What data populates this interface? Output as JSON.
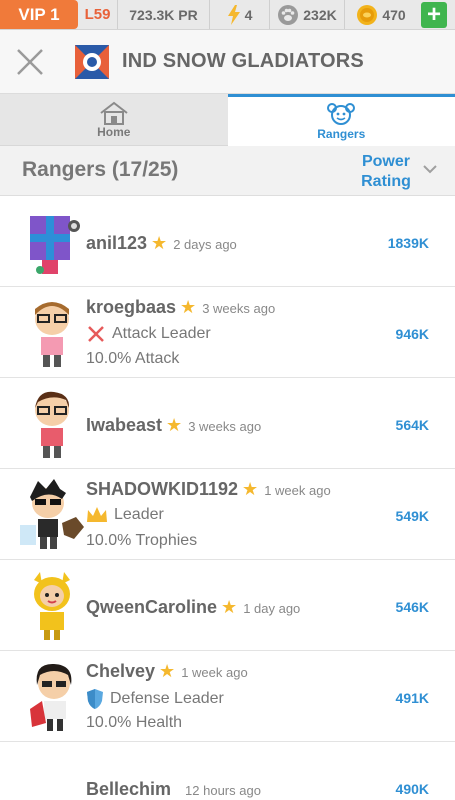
{
  "status_bar": {
    "vip": "VIP 1",
    "level": "L59",
    "power_rating": "723.3K PR",
    "energy": "4",
    "paws": "232K",
    "coins": "470",
    "plus": "+"
  },
  "team": {
    "name": "IND SNOW GLADIATORS"
  },
  "tabs": [
    {
      "label": "Home",
      "icon": "house-icon",
      "active": false
    },
    {
      "label": "Rangers",
      "icon": "rangers-icon",
      "active": true
    }
  ],
  "section": {
    "title": "Rangers (17/25)",
    "sort_line1": "Power",
    "sort_line2": "Rating"
  },
  "colors": {
    "accent": "#2f8fd3",
    "vip": "#f07a3a",
    "star": "#f5b82e",
    "plus": "#3fb54e"
  },
  "rangers": [
    {
      "name": "anil123",
      "seen": "2 days ago",
      "role": "",
      "bonus": "",
      "power": "1839K",
      "avatar": "gift-box-avatar"
    },
    {
      "name": "kroegbaas",
      "seen": "3 weeks ago",
      "role": "Attack Leader",
      "role_icon": "swords-icon",
      "bonus": "10.0% Attack",
      "power": "946K",
      "avatar": "glasses-avatar"
    },
    {
      "name": "Iwabeast",
      "seen": "3 weeks ago",
      "role": "",
      "bonus": "",
      "power": "564K",
      "avatar": "glasses-avatar-2"
    },
    {
      "name": "SHADOWKID1192",
      "seen": "1 week ago",
      "role": "Leader",
      "role_icon": "crown-icon",
      "bonus": "10.0% Trophies",
      "power": "549K",
      "avatar": "shadow-avatar"
    },
    {
      "name": "QweenCaroline",
      "seen": "1 day ago",
      "role": "",
      "bonus": "",
      "power": "546K",
      "avatar": "yellow-avatar"
    },
    {
      "name": "Chelvey",
      "seen": "1 week ago",
      "role": "Defense Leader",
      "role_icon": "shield-icon",
      "bonus": "10.0% Health",
      "power": "491K",
      "avatar": "dark-hair-avatar"
    },
    {
      "name": "Bellechim",
      "seen": "12 hours ago",
      "role": "",
      "bonus": "",
      "power": "490K",
      "avatar": ""
    }
  ]
}
